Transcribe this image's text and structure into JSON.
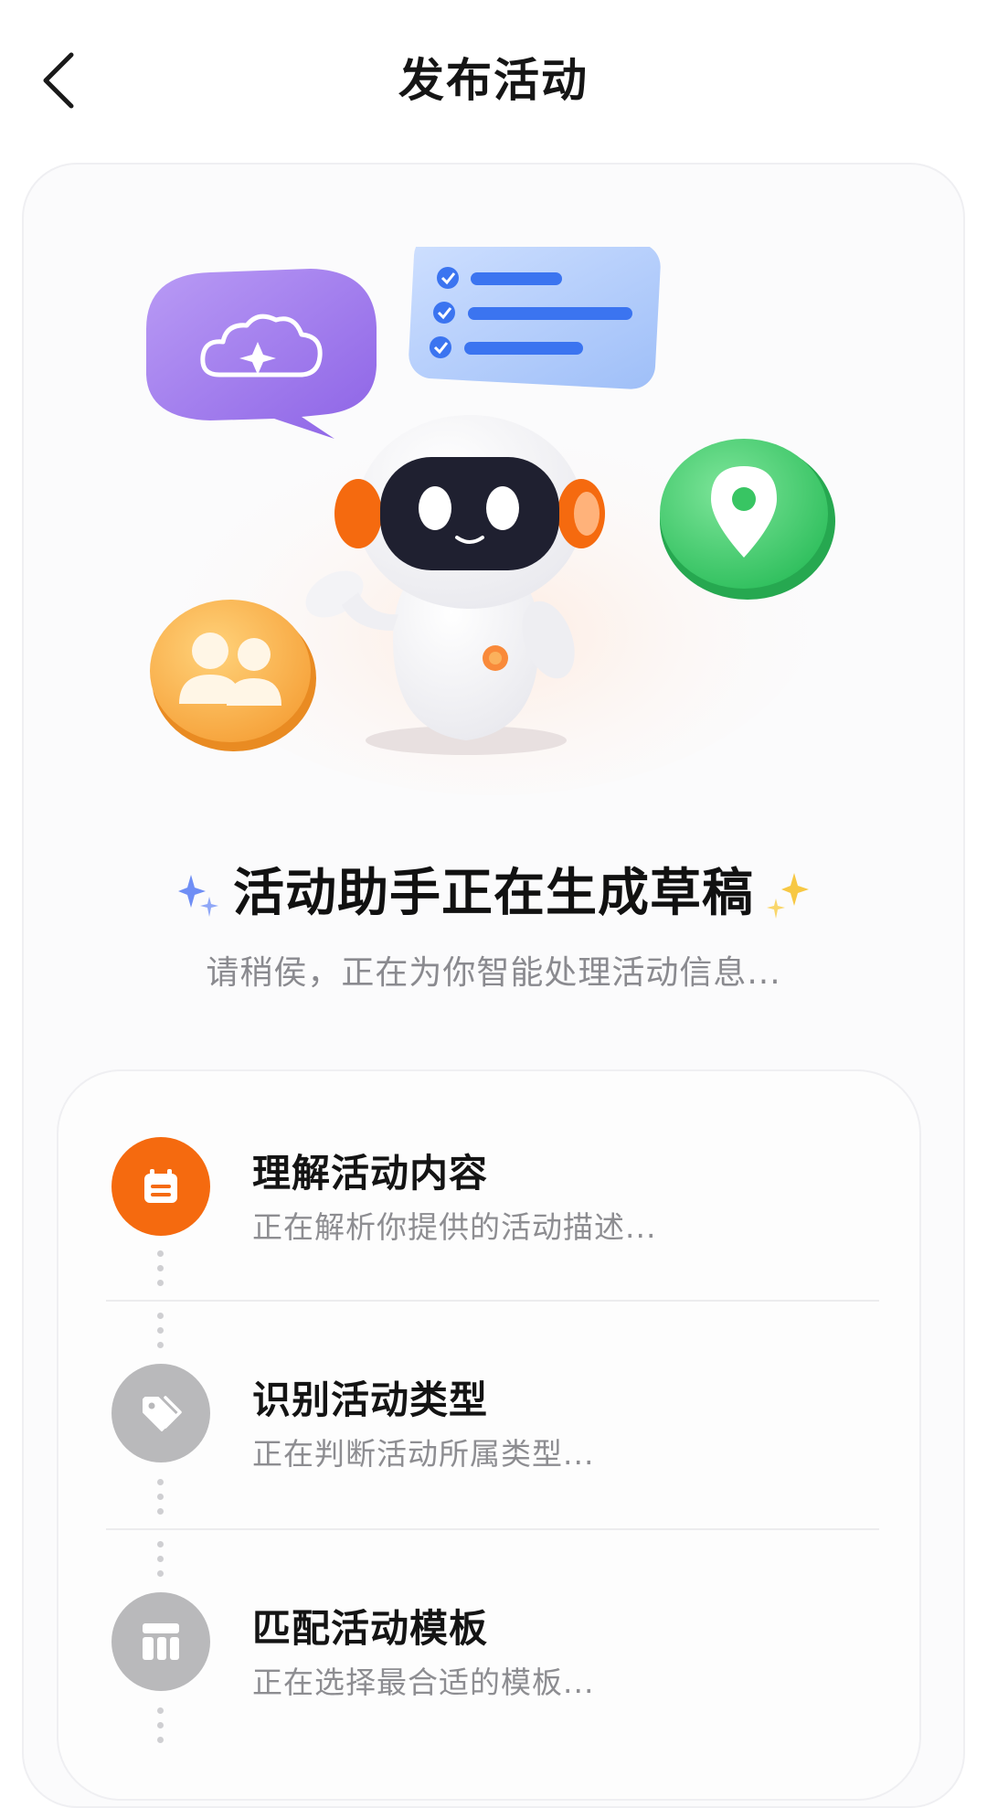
{
  "header": {
    "title": "发布活动"
  },
  "hero": {
    "title": "活动助手正在生成草稿",
    "subtitle": "请稍侯，正在为你智能处理活动信息..."
  },
  "steps": [
    {
      "title": "理解活动内容",
      "desc": "正在解析你提供的活动描述...",
      "state": "active",
      "icon": "calendar-icon"
    },
    {
      "title": "识别活动类型",
      "desc": "正在判断活动所属类型...",
      "state": "pending",
      "icon": "tag-icon"
    },
    {
      "title": "匹配活动模板",
      "desc": "正在选择最合适的模板...",
      "state": "pending",
      "icon": "template-icon"
    }
  ],
  "colors": {
    "accent": "#F56A0F",
    "pending": "#B9B9BB",
    "text": "#151515",
    "muted": "#8A8A8F"
  }
}
